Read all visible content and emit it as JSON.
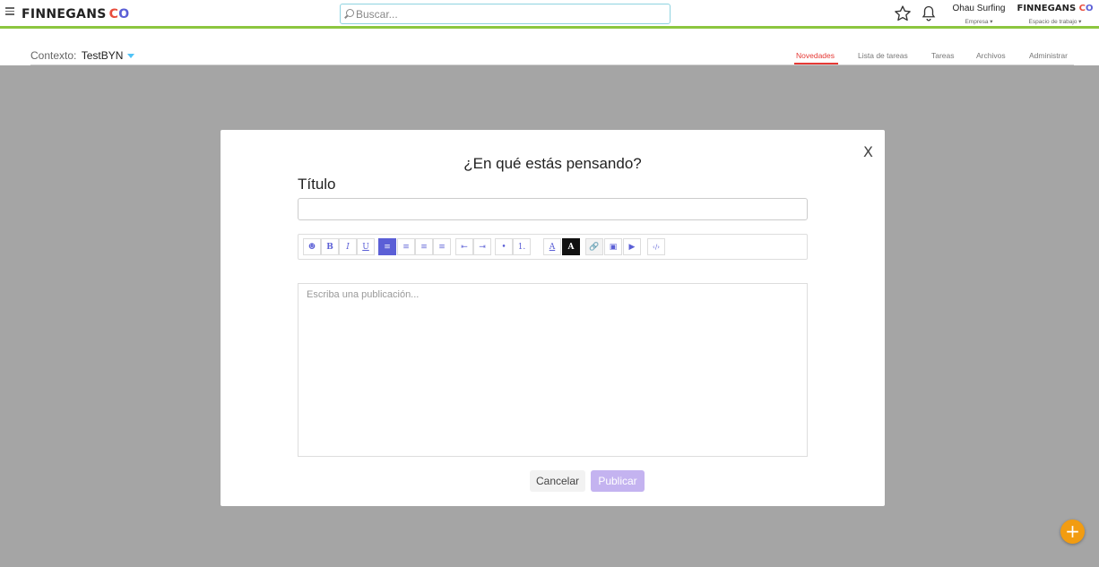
{
  "header": {
    "logo_text": "FINNEGANS",
    "logo_mark": "CO",
    "search_placeholder": "Buscar...",
    "company_name": "Ohau Surfing",
    "company_sub": "Empresa ▾",
    "workspace_name": "FINNEGANS",
    "workspace_mark": "CO",
    "workspace_sub": "Espacio de trabajo ▾",
    "accent_green": "#8cc63f"
  },
  "context": {
    "label": "Contexto:",
    "value": "TestBYN"
  },
  "tabs": [
    {
      "label": "Novedades",
      "active": true
    },
    {
      "label": "Lista de tareas",
      "active": false
    },
    {
      "label": "Tareas",
      "active": false
    },
    {
      "label": "Archivos",
      "active": false
    },
    {
      "label": "Administrar",
      "active": false
    }
  ],
  "modal": {
    "close_label": "X",
    "title": "¿En qué estás pensando?",
    "field_label": "Título",
    "title_value": "",
    "editor_placeholder": "Escriba una publicación...",
    "cancel_label": "Cancelar",
    "publish_label": "Publicar",
    "toolbar": [
      {
        "icon": "emoji-icon",
        "glyph": "☻"
      },
      {
        "icon": "bold-icon",
        "glyph": "B"
      },
      {
        "icon": "italic-icon",
        "glyph": "I"
      },
      {
        "icon": "underline-icon",
        "glyph": "U"
      },
      {
        "icon": "align-left-icon",
        "glyph": "≡"
      },
      {
        "icon": "align-center-icon",
        "glyph": "≡"
      },
      {
        "icon": "align-right-icon",
        "glyph": "≡"
      },
      {
        "icon": "align-justify-icon",
        "glyph": "≡"
      },
      {
        "icon": "outdent-icon",
        "glyph": "⇤"
      },
      {
        "icon": "indent-icon",
        "glyph": "⇥"
      },
      {
        "icon": "bullet-list-icon",
        "glyph": "•"
      },
      {
        "icon": "numbered-list-icon",
        "glyph": "1."
      },
      {
        "icon": "text-color-icon",
        "glyph": "A"
      },
      {
        "icon": "background-color-icon",
        "glyph": "A"
      },
      {
        "icon": "link-icon",
        "glyph": "🔗"
      },
      {
        "icon": "image-icon",
        "glyph": "▣"
      },
      {
        "icon": "video-icon",
        "glyph": "▶"
      },
      {
        "icon": "code-icon",
        "glyph": "‹/›"
      }
    ]
  },
  "fab": {
    "glyph": "+",
    "color": "#f29c11"
  }
}
